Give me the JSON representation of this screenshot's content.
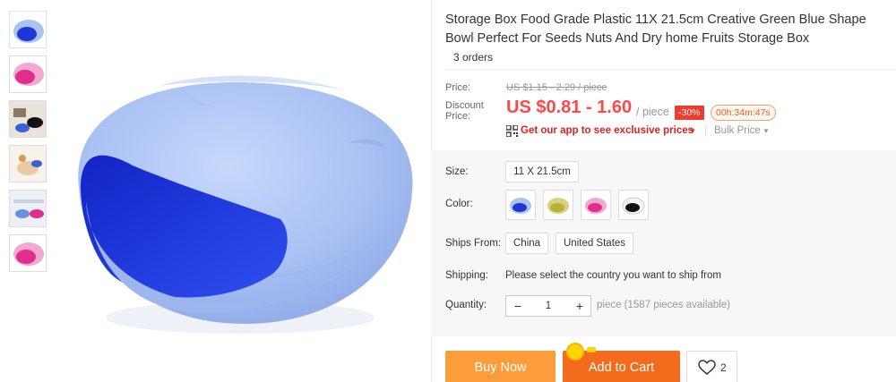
{
  "product": {
    "title": "Storage Box Food Grade Plastic 11X 21.5cm Creative Green Blue Shape Bowl Perfect For Seeds Nuts And Dry home Fruits Storage Box",
    "orders": "3 orders"
  },
  "thumbnails": [
    {
      "name": "blue-bowl"
    },
    {
      "name": "pink-bowl"
    },
    {
      "name": "lifestyle-photo"
    },
    {
      "name": "hand-photo"
    },
    {
      "name": "table-photo"
    },
    {
      "name": "pink-bowl-2"
    }
  ],
  "price": {
    "price_label": "Price:",
    "original": "US $1.15 - 2.29 / piece",
    "discount_label": "Discount Price:",
    "current": "US $0.81 - 1.60",
    "per_unit": "/ piece",
    "discount_badge": "-30%",
    "countdown": "00h:34m:47s",
    "app_promo": "Get our app to see exclusive prices",
    "bulk_price": "Bulk Price"
  },
  "options": {
    "size_label": "Size:",
    "size_value": "11 X 21.5cm",
    "color_label": "Color:",
    "colors": [
      {
        "name": "blue",
        "color": "#1f35d6"
      },
      {
        "name": "olive",
        "color": "#b8b13b"
      },
      {
        "name": "pink",
        "color": "#e02d8e"
      },
      {
        "name": "black",
        "color": "#111111"
      }
    ],
    "ships_from_label": "Ships From:",
    "ships_from": [
      "China",
      "United States"
    ],
    "shipping_label": "Shipping:",
    "shipping_text": "Please select the country you want to ship from",
    "quantity_label": "Quantity:",
    "quantity_value": "1",
    "quantity_minus": "−",
    "quantity_plus": "+",
    "quantity_note": "piece (1587 pieces available)"
  },
  "actions": {
    "buy_now": "Buy Now",
    "add_to_cart": "Add to Cart",
    "wishlist_count": "2"
  },
  "colors": {
    "price_red": "#ff4747",
    "buy_orange": "#fc9c3b",
    "cart_orange": "#f56b1d"
  }
}
